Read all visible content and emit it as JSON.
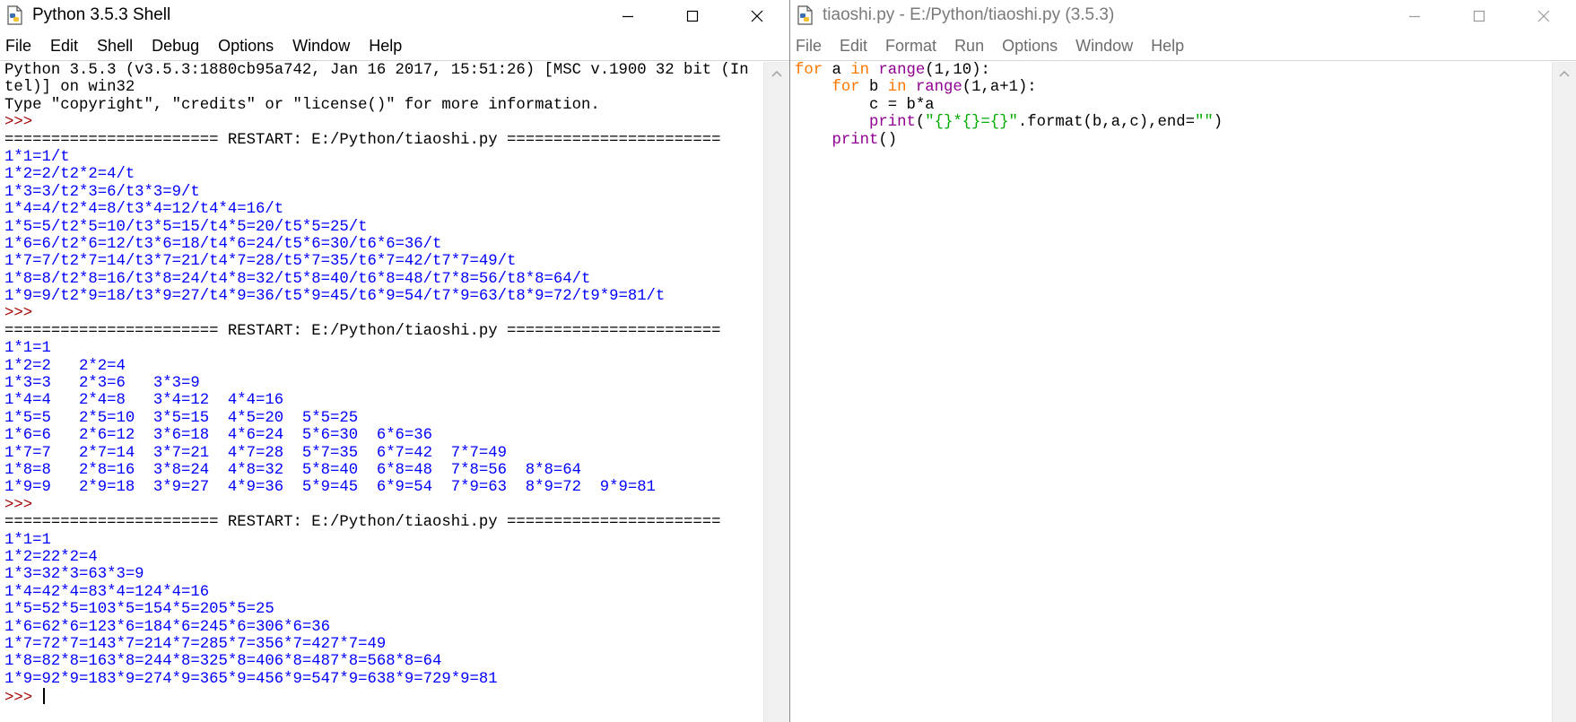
{
  "shell": {
    "title": "Python 3.5.3 Shell",
    "menu": [
      "File",
      "Edit",
      "Shell",
      "Debug",
      "Options",
      "Window",
      "Help"
    ],
    "lines": [
      {
        "t": "Python 3.5.3 (v3.5.3:1880cb95a742, Jan 16 2017, 15:51:26) [MSC v.1900 32 bit (In",
        "c": "std"
      },
      {
        "t": "tel)] on win32",
        "c": "std"
      },
      {
        "t": "Type \"copyright\", \"credits\" or \"license()\" for more information.",
        "c": "std"
      },
      {
        "t": ">>> ",
        "c": "prompt"
      },
      {
        "t": "======================= RESTART: E:/Python/tiaoshi.py =======================",
        "c": "std"
      },
      {
        "t": "1*1=1/t",
        "c": "out"
      },
      {
        "t": "1*2=2/t2*2=4/t",
        "c": "out"
      },
      {
        "t": "1*3=3/t2*3=6/t3*3=9/t",
        "c": "out"
      },
      {
        "t": "1*4=4/t2*4=8/t3*4=12/t4*4=16/t",
        "c": "out"
      },
      {
        "t": "1*5=5/t2*5=10/t3*5=15/t4*5=20/t5*5=25/t",
        "c": "out"
      },
      {
        "t": "1*6=6/t2*6=12/t3*6=18/t4*6=24/t5*6=30/t6*6=36/t",
        "c": "out"
      },
      {
        "t": "1*7=7/t2*7=14/t3*7=21/t4*7=28/t5*7=35/t6*7=42/t7*7=49/t",
        "c": "out"
      },
      {
        "t": "1*8=8/t2*8=16/t3*8=24/t4*8=32/t5*8=40/t6*8=48/t7*8=56/t8*8=64/t",
        "c": "out"
      },
      {
        "t": "1*9=9/t2*9=18/t3*9=27/t4*9=36/t5*9=45/t6*9=54/t7*9=63/t8*9=72/t9*9=81/t",
        "c": "out"
      },
      {
        "t": ">>> ",
        "c": "prompt"
      },
      {
        "t": "======================= RESTART: E:/Python/tiaoshi.py =======================",
        "c": "std"
      },
      {
        "t": "1*1=1",
        "c": "out"
      },
      {
        "t": "1*2=2   2*2=4",
        "c": "out"
      },
      {
        "t": "1*3=3   2*3=6   3*3=9",
        "c": "out"
      },
      {
        "t": "1*4=4   2*4=8   3*4=12  4*4=16",
        "c": "out"
      },
      {
        "t": "1*5=5   2*5=10  3*5=15  4*5=20  5*5=25",
        "c": "out"
      },
      {
        "t": "1*6=6   2*6=12  3*6=18  4*6=24  5*6=30  6*6=36",
        "c": "out"
      },
      {
        "t": "1*7=7   2*7=14  3*7=21  4*7=28  5*7=35  6*7=42  7*7=49",
        "c": "out"
      },
      {
        "t": "1*8=8   2*8=16  3*8=24  4*8=32  5*8=40  6*8=48  7*8=56  8*8=64",
        "c": "out"
      },
      {
        "t": "1*9=9   2*9=18  3*9=27  4*9=36  5*9=45  6*9=54  7*9=63  8*9=72  9*9=81",
        "c": "out"
      },
      {
        "t": ">>> ",
        "c": "prompt"
      },
      {
        "t": "======================= RESTART: E:/Python/tiaoshi.py =======================",
        "c": "std"
      },
      {
        "t": "1*1=1",
        "c": "out"
      },
      {
        "t": "1*2=22*2=4",
        "c": "out"
      },
      {
        "t": "1*3=32*3=63*3=9",
        "c": "out"
      },
      {
        "t": "1*4=42*4=83*4=124*4=16",
        "c": "out"
      },
      {
        "t": "1*5=52*5=103*5=154*5=205*5=25",
        "c": "out"
      },
      {
        "t": "1*6=62*6=123*6=184*6=245*6=306*6=36",
        "c": "out"
      },
      {
        "t": "1*7=72*7=143*7=214*7=285*7=356*7=427*7=49",
        "c": "out"
      },
      {
        "t": "1*8=82*8=163*8=244*8=325*8=406*8=487*8=568*8=64",
        "c": "out"
      },
      {
        "t": "1*9=92*9=183*9=274*9=365*9=456*9=547*9=638*9=729*9=81",
        "c": "out"
      }
    ],
    "final_prompt": ">>> "
  },
  "editor": {
    "title": "tiaoshi.py - E:/Python/tiaoshi.py (3.5.3)",
    "menu": [
      "File",
      "Edit",
      "Format",
      "Run",
      "Options",
      "Window",
      "Help"
    ],
    "code": [
      [
        {
          "t": "for",
          "k": "kw"
        },
        {
          "t": " a "
        },
        {
          "t": "in",
          "k": "kw"
        },
        {
          "t": " "
        },
        {
          "t": "range",
          "k": "bi"
        },
        {
          "t": "(1,10):"
        }
      ],
      [
        {
          "t": "    "
        },
        {
          "t": "for",
          "k": "kw"
        },
        {
          "t": " b "
        },
        {
          "t": "in",
          "k": "kw"
        },
        {
          "t": " "
        },
        {
          "t": "range",
          "k": "bi"
        },
        {
          "t": "(1,a+1):"
        }
      ],
      [
        {
          "t": "        c = b*a"
        }
      ],
      [
        {
          "t": "        "
        },
        {
          "t": "print",
          "k": "bi"
        },
        {
          "t": "("
        },
        {
          "t": "\"{}*{}={}\"",
          "k": "str"
        },
        {
          "t": ".format(b,a,c),end="
        },
        {
          "t": "\"\"",
          "k": "str"
        },
        {
          "t": ")"
        }
      ],
      [
        {
          "t": "    "
        },
        {
          "t": "print",
          "k": "bi"
        },
        {
          "t": "()"
        }
      ]
    ]
  },
  "icons": [
    "python-file-icon",
    "minimize-icon",
    "maximize-icon",
    "close-icon",
    "scroll-up-arrow-icon"
  ],
  "colors": {
    "output": "#0000ff",
    "prompt": "#a30000",
    "keyword": "#ff7700",
    "builtin": "#900090",
    "string": "#00aa00"
  }
}
